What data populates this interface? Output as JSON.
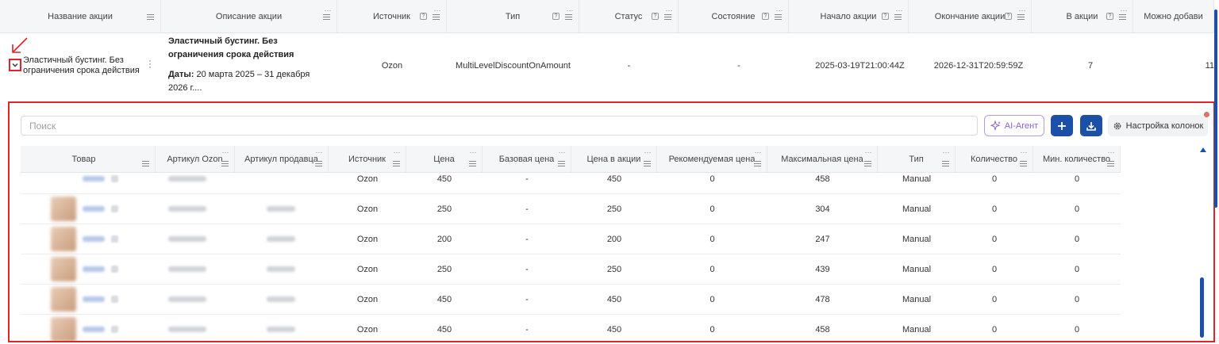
{
  "top_header": {
    "columns": [
      {
        "label": "Название акции",
        "width": 203
      },
      {
        "label": "Описание акции",
        "width": 222
      },
      {
        "label": "Источник",
        "width": 138
      },
      {
        "label": "Тип",
        "width": 167
      },
      {
        "label": "Статус",
        "width": 125
      },
      {
        "label": "Состояние",
        "width": 139
      },
      {
        "label": "Начало акции",
        "width": 151
      },
      {
        "label": "Окончание акции",
        "width": 155
      },
      {
        "label": "В акции",
        "width": 128
      },
      {
        "label": "Можно добави",
        "width": 102
      }
    ]
  },
  "main_row": {
    "name": "Эластичный бустинг. Без ограничения срока действия",
    "desc_title": "Эластичный бустинг. Без ограничения срока действия",
    "desc_dates_label": "Даты:",
    "desc_dates": "20 марта 2025 – 31 декабря 2026 г....",
    "source": "Ozon",
    "type": "MultiLevelDiscountOnAmount",
    "status": "-",
    "state": "-",
    "start": "2025-03-19T21:00:44Z",
    "end": "2026-12-31T20:59:59Z",
    "in_promo": "7",
    "can_add": "11"
  },
  "toolbar": {
    "search_placeholder": "Поиск",
    "ai_label": "AI-Агент",
    "columns_label": "Настройка колонок"
  },
  "inner_table": {
    "columns": [
      {
        "label": "Товар",
        "width": 170
      },
      {
        "label": "Артикул Ozon",
        "width": 100
      },
      {
        "label": "Артикул продавца",
        "width": 118
      },
      {
        "label": "Источник",
        "width": 98
      },
      {
        "label": "Цена",
        "width": 96
      },
      {
        "label": "Базовая цена",
        "width": 112
      },
      {
        "label": "Цена в акции",
        "width": 108
      },
      {
        "label": "Рекомендуемая цена",
        "width": 139
      },
      {
        "label": "Максимальная цена",
        "width": 139
      },
      {
        "label": "Тип",
        "width": 98
      },
      {
        "label": "Количество",
        "width": 98
      },
      {
        "label": "Мин. количество",
        "width": 110
      }
    ],
    "rows": [
      {
        "source": "Ozon",
        "price": "450",
        "base_price": "-",
        "promo_price": "450",
        "rec_price": "0",
        "max_price": "458",
        "type": "Manual",
        "qty": "0",
        "min_qty": "0"
      },
      {
        "source": "Ozon",
        "price": "250",
        "base_price": "-",
        "promo_price": "250",
        "rec_price": "0",
        "max_price": "304",
        "type": "Manual",
        "qty": "0",
        "min_qty": "0"
      },
      {
        "source": "Ozon",
        "price": "200",
        "base_price": "-",
        "promo_price": "200",
        "rec_price": "0",
        "max_price": "247",
        "type": "Manual",
        "qty": "0",
        "min_qty": "0"
      },
      {
        "source": "Ozon",
        "price": "250",
        "base_price": "-",
        "promo_price": "250",
        "rec_price": "0",
        "max_price": "439",
        "type": "Manual",
        "qty": "0",
        "min_qty": "0"
      },
      {
        "source": "Ozon",
        "price": "450",
        "base_price": "-",
        "promo_price": "450",
        "rec_price": "0",
        "max_price": "478",
        "type": "Manual",
        "qty": "0",
        "min_qty": "0"
      },
      {
        "source": "Ozon",
        "price": "450",
        "base_price": "-",
        "promo_price": "450",
        "rec_price": "0",
        "max_price": "458",
        "type": "Manual",
        "qty": "0",
        "min_qty": "0"
      }
    ]
  },
  "colors": {
    "accent": "#1c4fa8",
    "annotation_red": "#e0242a",
    "ai_purple": "#8a63d2"
  },
  "icons": [
    "chevron-down-icon",
    "sparkle-icon",
    "plus-icon",
    "download-icon",
    "gear-icon",
    "menu-dots-icon",
    "hamburger-icon",
    "help-icon",
    "kebab-icon"
  ]
}
